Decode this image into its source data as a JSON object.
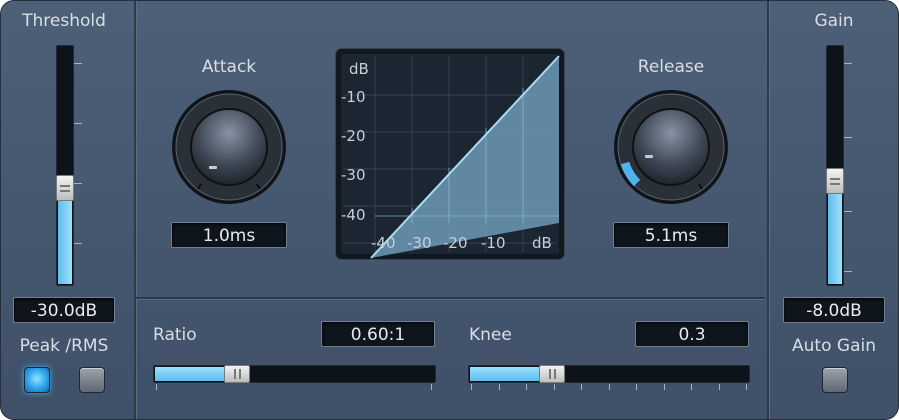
{
  "threshold": {
    "label": "Threshold",
    "readout": "-30.0dB",
    "level": 0.4
  },
  "peak_rms": {
    "label": "Peak /RMS",
    "peak_on": true,
    "rms_on": false
  },
  "attack": {
    "label": "Attack",
    "readout": "1.0ms"
  },
  "release": {
    "label": "Release",
    "readout": "5.1ms"
  },
  "graph": {
    "unit": "dB",
    "y_ticks": [
      "-10",
      "-20",
      "-30",
      "-40"
    ],
    "x_ticks": [
      "-40",
      "-30",
      "-20",
      "-10"
    ],
    "x_unit": "dB"
  },
  "ratio": {
    "label": "Ratio",
    "readout": "0.60:1",
    "level": 0.27
  },
  "knee": {
    "label": "Knee",
    "readout": "0.3",
    "level": 0.27
  },
  "gain": {
    "label": "Gain",
    "readout": "-8.0dB",
    "level": 0.43
  },
  "auto_gain": {
    "label": "Auto Gain",
    "on": false
  },
  "colors": {
    "panel": "#46586e",
    "accent": "#5fbde9",
    "display_bg": "#101820"
  }
}
